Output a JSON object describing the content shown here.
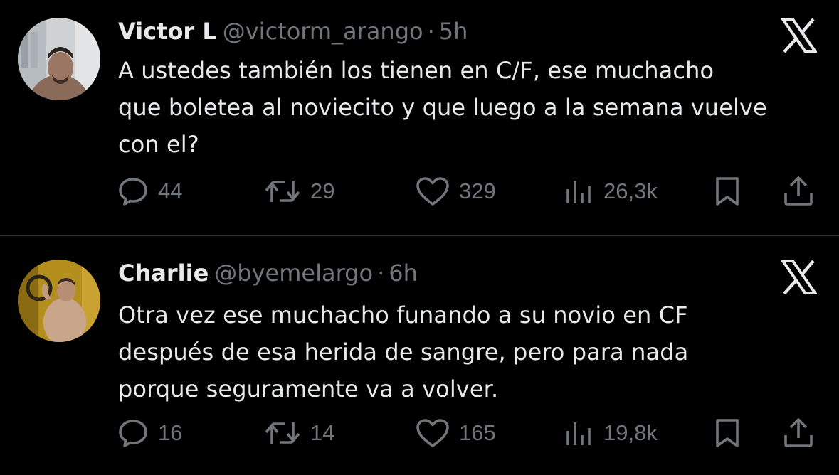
{
  "tweets": [
    {
      "author_name": "Victor L",
      "handle": "@victorm_arango",
      "separator": "·",
      "time": "5h",
      "text_lines": [
        "A ustedes también los tienen en C/F, ese muchacho",
        "que boletea al noviecito y que luego a la semana vuelve",
        "con el?"
      ],
      "stats": {
        "replies": "44",
        "reposts": "29",
        "likes": "329",
        "views": "26,3k"
      },
      "avatar_icon": "avatar-photo",
      "brand_icon": "x-logo-icon"
    },
    {
      "author_name": "Charlie",
      "handle": "@byemelargo",
      "separator": "·",
      "time": "6h",
      "text_lines": [
        "Otra vez ese muchacho funando a su novio en CF",
        "después de esa herida de sangre, pero para nada",
        "porque seguramente va a volver."
      ],
      "stats": {
        "replies": "16",
        "reposts": "14",
        "likes": "165",
        "views": "19,8k"
      },
      "avatar_icon": "avatar-photo",
      "brand_icon": "x-logo-icon"
    }
  ],
  "colors": {
    "background": "#000000",
    "primary_text": "#e7e9ea",
    "secondary_text": "#71767b",
    "divider": "#2f3336"
  },
  "icons": [
    "reply-icon",
    "repost-icon",
    "like-icon",
    "views-icon",
    "bookmark-icon",
    "share-icon",
    "x-logo-icon"
  ]
}
